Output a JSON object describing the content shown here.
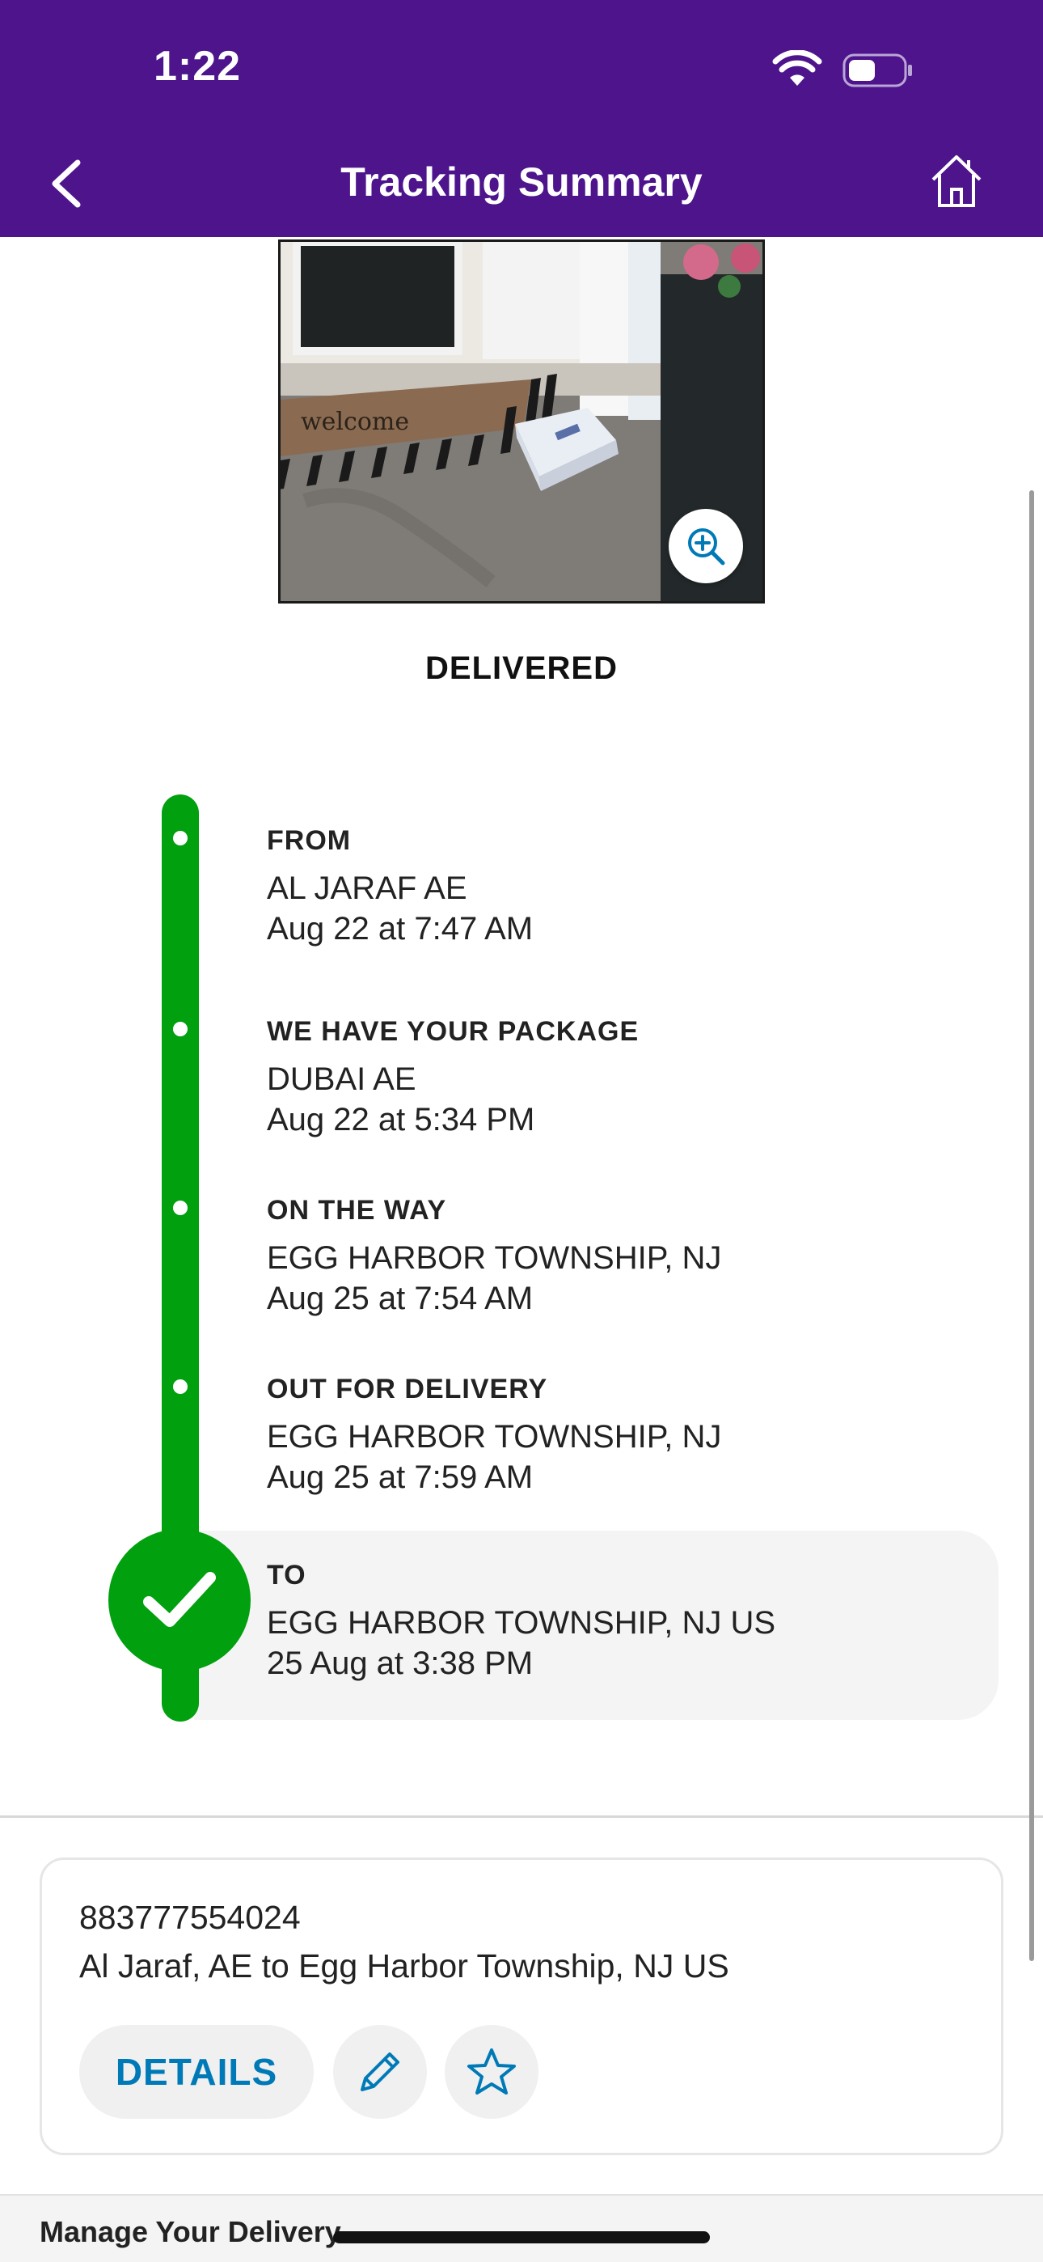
{
  "status_bar": {
    "time": "1:22"
  },
  "nav": {
    "title": "Tracking Summary",
    "back_icon": "chevron-left-icon",
    "home_icon": "home-icon"
  },
  "photo": {
    "mat_text": "welcome",
    "zoom_icon": "zoom-in-icon"
  },
  "status": "DELIVERED",
  "timeline": [
    {
      "label": "FROM",
      "location": "AL JARAF AE",
      "time": "Aug 22 at 7:47 AM"
    },
    {
      "label": "WE HAVE YOUR PACKAGE",
      "location": "DUBAI AE",
      "time": "Aug 22 at 5:34 PM"
    },
    {
      "label": "ON THE WAY",
      "location": "EGG HARBOR TOWNSHIP, NJ",
      "time": "Aug 25 at 7:54 AM"
    },
    {
      "label": "OUT FOR DELIVERY",
      "location": "EGG HARBOR TOWNSHIP, NJ",
      "time": "Aug 25 at 7:59 AM"
    },
    {
      "label": "TO",
      "location": "EGG HARBOR TOWNSHIP, NJ US",
      "time": "25 Aug at 3:38 PM"
    }
  ],
  "shipment": {
    "tracking_number": "883777554024",
    "route": "Al Jaraf, AE to Egg Harbor Township, NJ US",
    "details_label": "DETAILS",
    "edit_icon": "pencil-icon",
    "favorite_icon": "star-icon"
  },
  "footer": {
    "manage_label": "Manage Your Delivery"
  },
  "colors": {
    "brand_purple": "#4d148c",
    "timeline_green": "#00a00e",
    "link_blue": "#007ab7"
  }
}
